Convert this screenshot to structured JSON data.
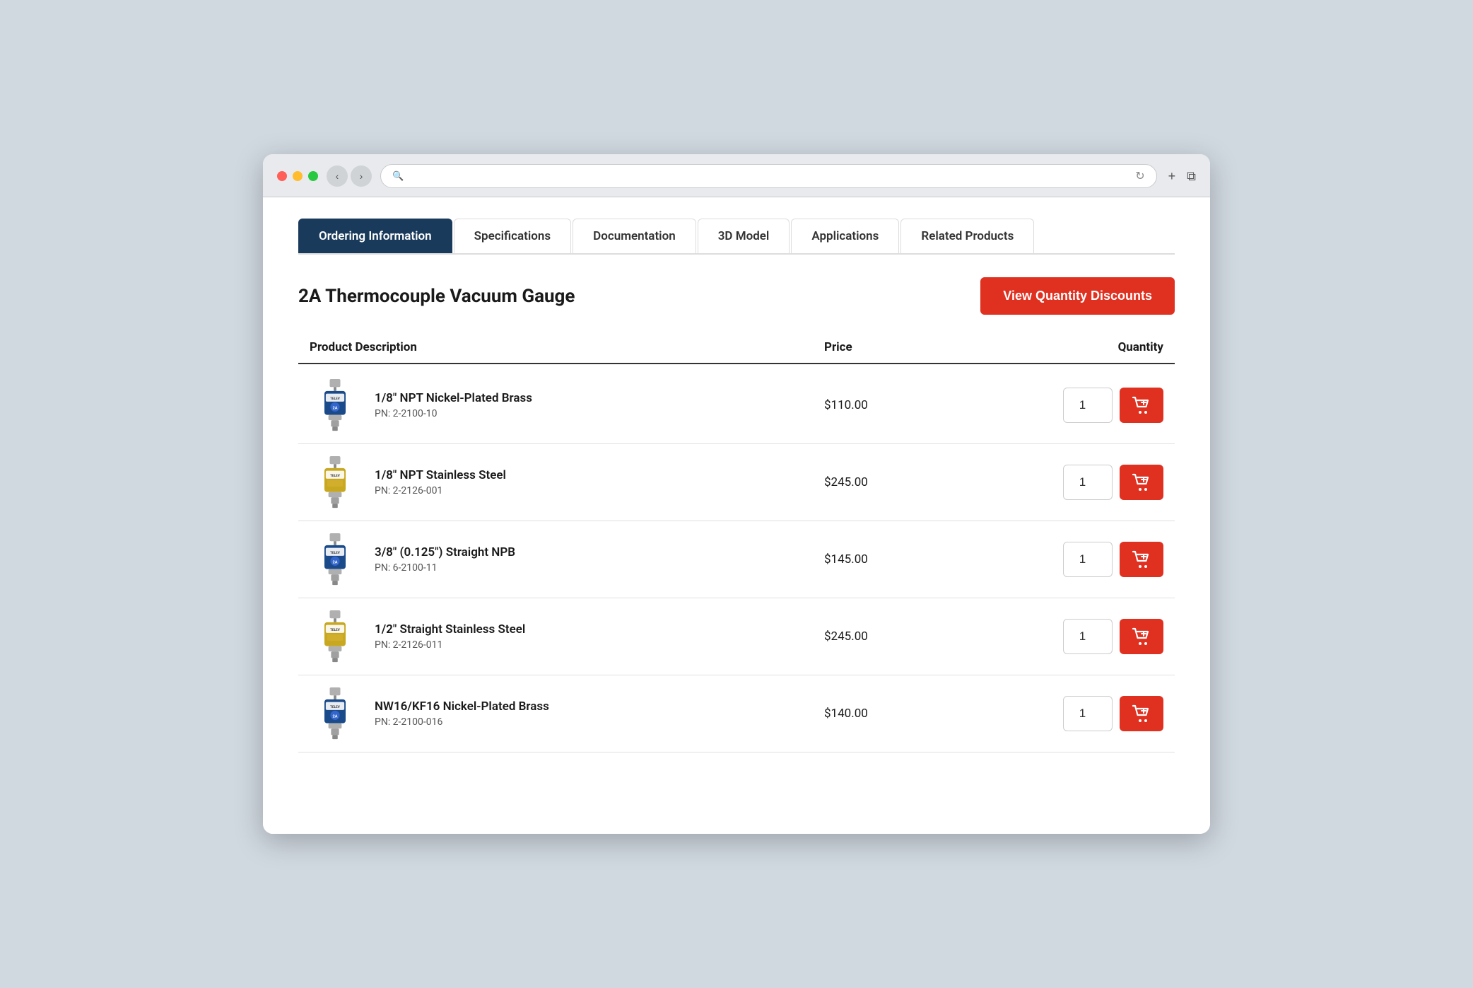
{
  "browser": {
    "traffic_lights": [
      "red",
      "yellow",
      "green"
    ],
    "nav_back": "‹",
    "nav_forward": "›",
    "search_placeholder": "",
    "reload_icon": "↻",
    "plus_icon": "+",
    "windows_icon": "⧉"
  },
  "tabs": [
    {
      "id": "ordering",
      "label": "Ordering Information",
      "active": true
    },
    {
      "id": "specifications",
      "label": "Specifications",
      "active": false
    },
    {
      "id": "documentation",
      "label": "Documentation",
      "active": false
    },
    {
      "id": "3dmodel",
      "label": "3D Model",
      "active": false
    },
    {
      "id": "applications",
      "label": "Applications",
      "active": false
    },
    {
      "id": "related",
      "label": "Related Products",
      "active": false
    }
  ],
  "page": {
    "product_title": "2A Thermocouple Vacuum Gauge",
    "view_discounts_label": "View Quantity Discounts",
    "columns": {
      "description": "Product Description",
      "price": "Price",
      "quantity": "Quantity"
    }
  },
  "products": [
    {
      "name": "1/8\" NPT Nickel-Plated Brass",
      "pn": "PN: 2-2100-10",
      "price": "$110.00",
      "qty": "1",
      "color": "blue"
    },
    {
      "name": "1/8\" NPT Stainless Steel",
      "pn": "PN: 2-2126-001",
      "price": "$245.00",
      "qty": "1",
      "color": "gold"
    },
    {
      "name": "3/8\" (0.125\") Straight NPB",
      "pn": "PN: 6-2100-11",
      "price": "$145.00",
      "qty": "1",
      "color": "blue2"
    },
    {
      "name": "1/2\" Straight Stainless Steel",
      "pn": "PN: 2-2126-011",
      "price": "$245.00",
      "qty": "1",
      "color": "gold2"
    },
    {
      "name": "NW16/KF16 Nickel-Plated Brass",
      "pn": "PN: 2-2100-016",
      "price": "$140.00",
      "qty": "1",
      "color": "blue3"
    }
  ]
}
